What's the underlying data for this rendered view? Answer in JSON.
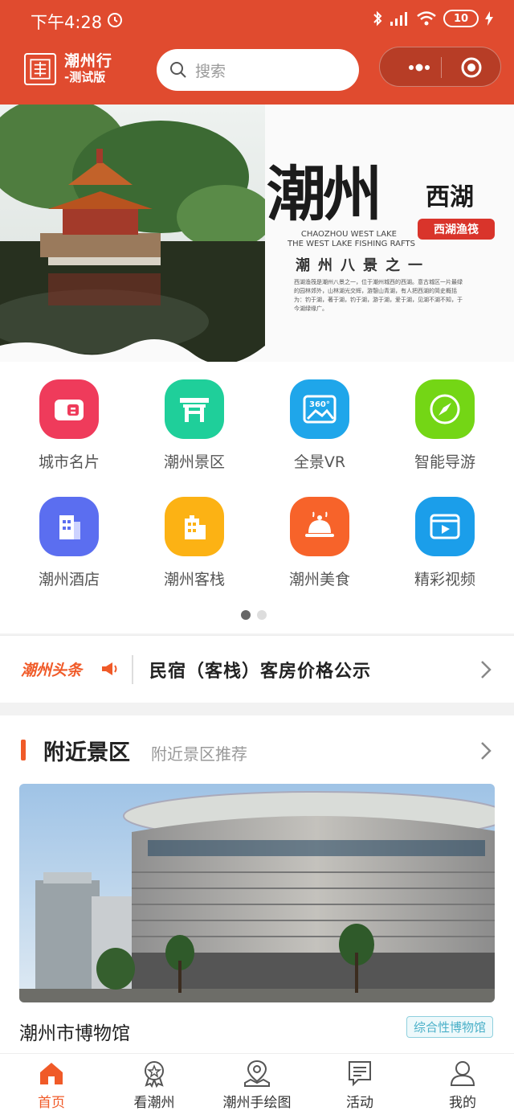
{
  "status_bar": {
    "time": "下午4:28",
    "battery": "10"
  },
  "header": {
    "logo_line1": "潮州行",
    "logo_line2": "-测试版",
    "search_placeholder": "搜索"
  },
  "banner": {
    "title": "潮州",
    "subtitle": "西湖",
    "seal": "西湖渔筏",
    "en_line1": "CHAOZHOU WEST LAKE",
    "en_line2": "THE WEST LAKE FISHING RAFTS",
    "tagline": "潮州八景之一",
    "small_text": "西湖渔筏是潮州八景之一，位于潮州城西的西湖。意古城区一片最绿的园林郊外，山林湖光交辉，游憩山青湖，有人把西湖的简史概括为：钓于湖，著于湖，钓于湖，游于湖，爱于湖，见湖不湖不知，于今湖绿缘广。"
  },
  "grid": [
    {
      "label": "城市名片",
      "icon": "card-icon",
      "color": "#ef3b5b"
    },
    {
      "label": "潮州景区",
      "icon": "pavilion-icon",
      "color": "#1fcf9a"
    },
    {
      "label": "全景VR",
      "icon": "panorama-360-icon",
      "color": "#1fa6ea"
    },
    {
      "label": "智能导游",
      "icon": "compass-icon",
      "color": "#74d615"
    },
    {
      "label": "潮州酒店",
      "icon": "hotel-icon",
      "color": "#5b6ef0"
    },
    {
      "label": "潮州客栈",
      "icon": "inn-icon",
      "color": "#fcb214"
    },
    {
      "label": "潮州美食",
      "icon": "food-cloche-icon",
      "color": "#f7632a"
    },
    {
      "label": "精彩视频",
      "icon": "video-icon",
      "color": "#1b9eea"
    }
  ],
  "headline": {
    "brand": "潮州头条",
    "text": "民宿（客栈）客房价格公示"
  },
  "nearby": {
    "title": "附近景区",
    "subtitle": "附近景区推荐",
    "spot_name": "潮州市博物馆",
    "spot_tag": "综合性博物馆"
  },
  "tabbar": [
    {
      "label": "首页",
      "icon": "home-icon"
    },
    {
      "label": "看潮州",
      "icon": "badge-icon"
    },
    {
      "label": "潮州手绘图",
      "icon": "map-pin-icon"
    },
    {
      "label": "活动",
      "icon": "list-icon"
    },
    {
      "label": "我的",
      "icon": "user-icon"
    }
  ],
  "colors": {
    "primary": "#e04b2f",
    "accent": "#f05a28",
    "tag": "#4ab0c8"
  }
}
